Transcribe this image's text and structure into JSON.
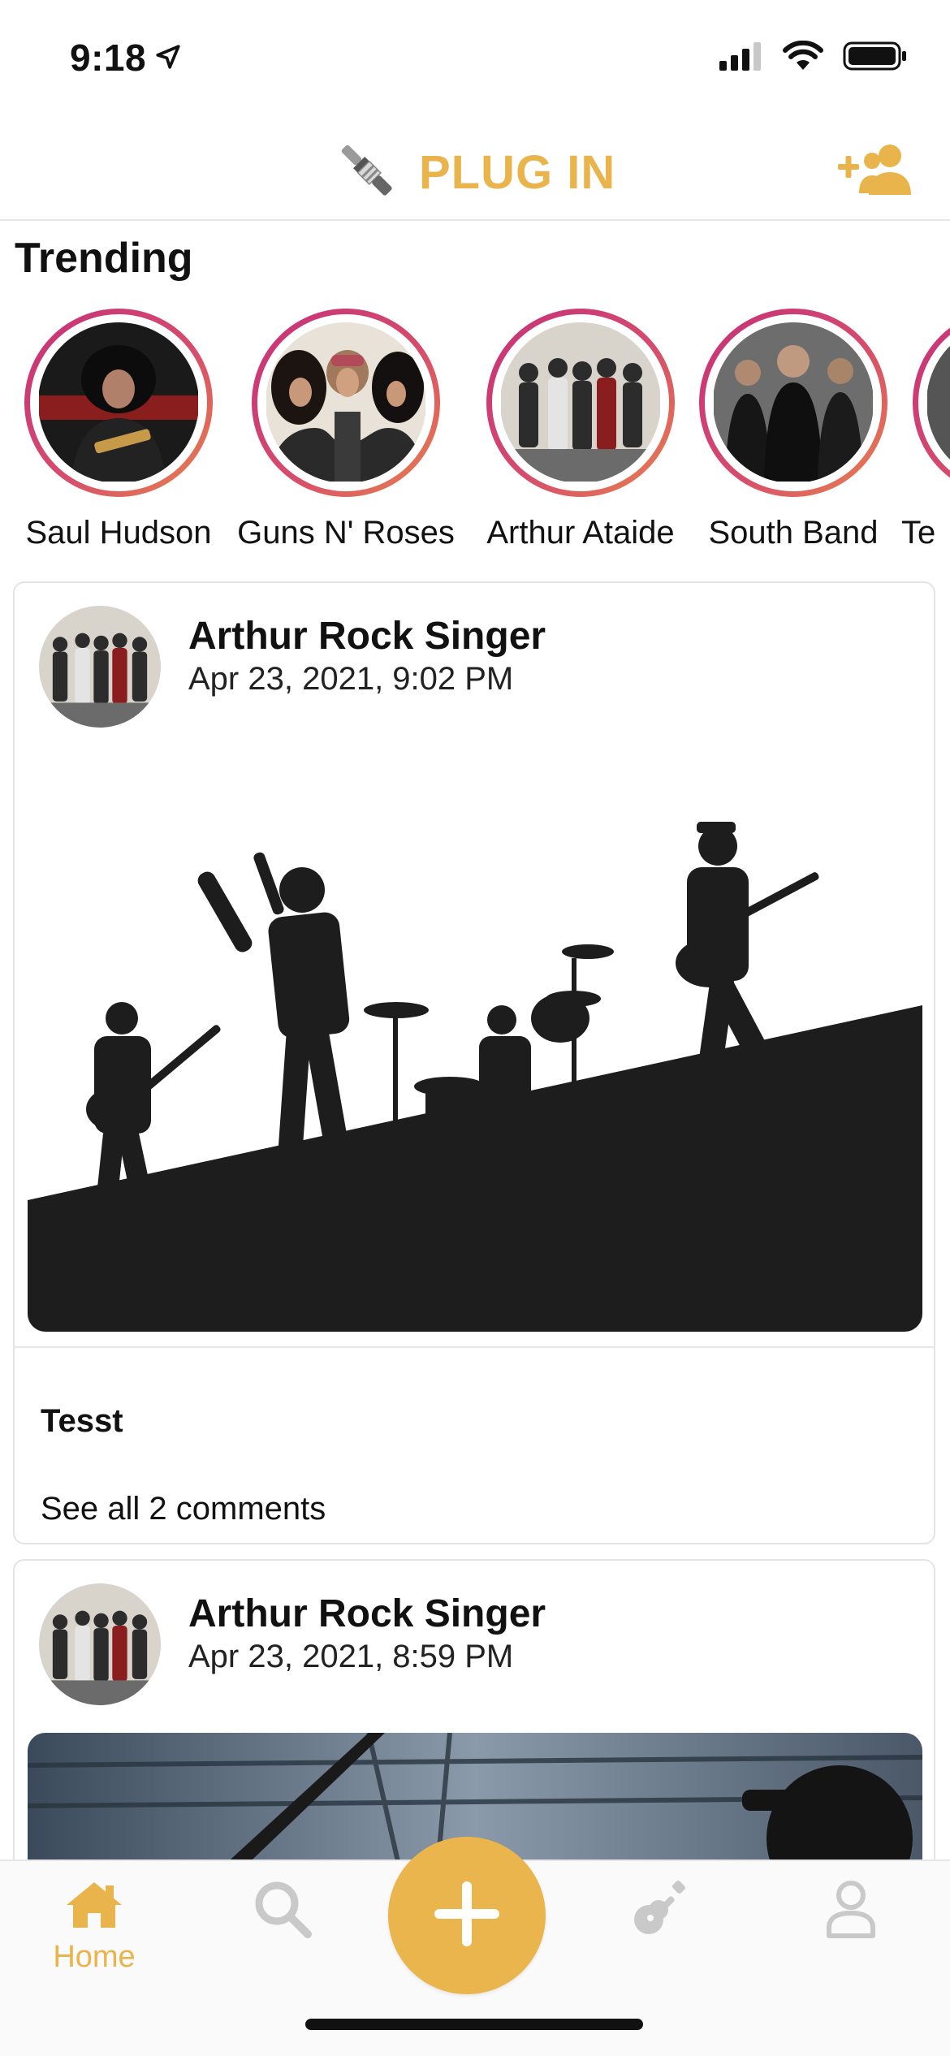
{
  "status_bar": {
    "time": "9:18"
  },
  "header": {
    "title": "PLUG IN"
  },
  "trending": {
    "title": "Trending",
    "items": [
      {
        "name": "Saul Hudson"
      },
      {
        "name": "Guns N' Roses"
      },
      {
        "name": "Arthur Ataide"
      },
      {
        "name": "South Band"
      },
      {
        "name": "Te"
      }
    ]
  },
  "posts": [
    {
      "user": "Arthur Rock Singer",
      "date": "Apr 23, 2021, 9:02 PM",
      "caption": "Tesst",
      "comments": "See all 2 comments"
    },
    {
      "user": "Arthur Rock Singer",
      "date": "Apr 23, 2021, 8:59 PM"
    }
  ],
  "tabbar": {
    "home_label": "Home",
    "active_color": "#e9b44c",
    "inactive_color": "#c9c9c9"
  }
}
